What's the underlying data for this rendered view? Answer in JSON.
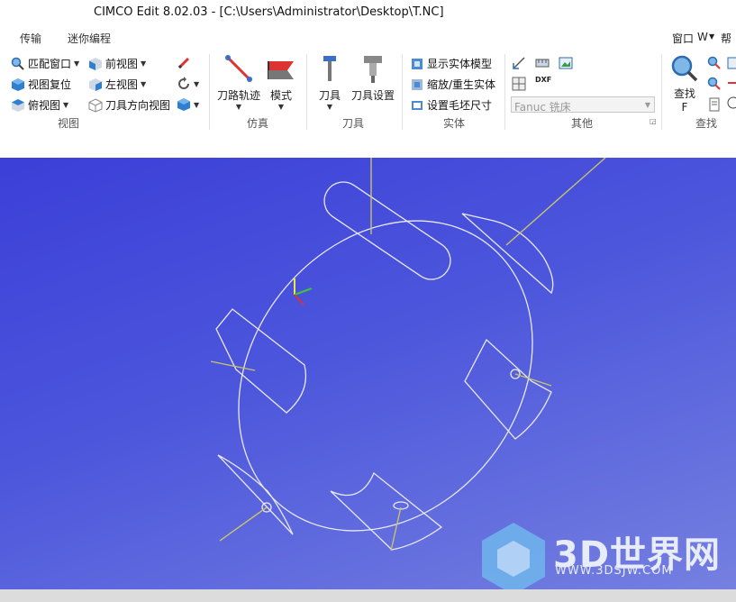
{
  "window": {
    "title": "CIMCO Edit 8.02.03 - [C:\\Users\\Administrator\\Desktop\\T.NC]"
  },
  "menu_tabs": [
    "传输",
    "迷你编程"
  ],
  "top_right": {
    "window_menu": "窗口",
    "w_label": "W",
    "help": "帮助"
  },
  "ribbon": {
    "view": {
      "fit_window": "匹配窗口",
      "reset_view": "视图复位",
      "top_view": "俯视图",
      "front_view": "前视图",
      "left_view": "左视图",
      "tool_dir_view": "刀具方向视图",
      "group_label": "视图"
    },
    "simulation": {
      "toolpath": "刀路轨迹",
      "mode": "模式",
      "group_label": "仿真"
    },
    "tool": {
      "tool": "刀具",
      "tool_settings": "刀具设置",
      "group_label": "刀具"
    },
    "solid": {
      "show_solid": "显示实体模型",
      "zoom_regen": "缩放/重生实体",
      "set_stock": "设置毛坯尺寸",
      "group_label": "实体"
    },
    "other": {
      "machine_select": "Fanuc 铣床",
      "dxf_label": "DXF",
      "group_label": "其他"
    },
    "find": {
      "find": "查找",
      "find_key": "F",
      "group_label": "查找"
    }
  },
  "watermark": {
    "brand": "3D世界网",
    "url": "WWW.3DSJW.COM"
  },
  "colors": {
    "viewport_top": "#3c3fd8",
    "viewport_bottom": "#7580e0",
    "wire": "#e8e8f8",
    "tool_line": "#c8c36a"
  }
}
